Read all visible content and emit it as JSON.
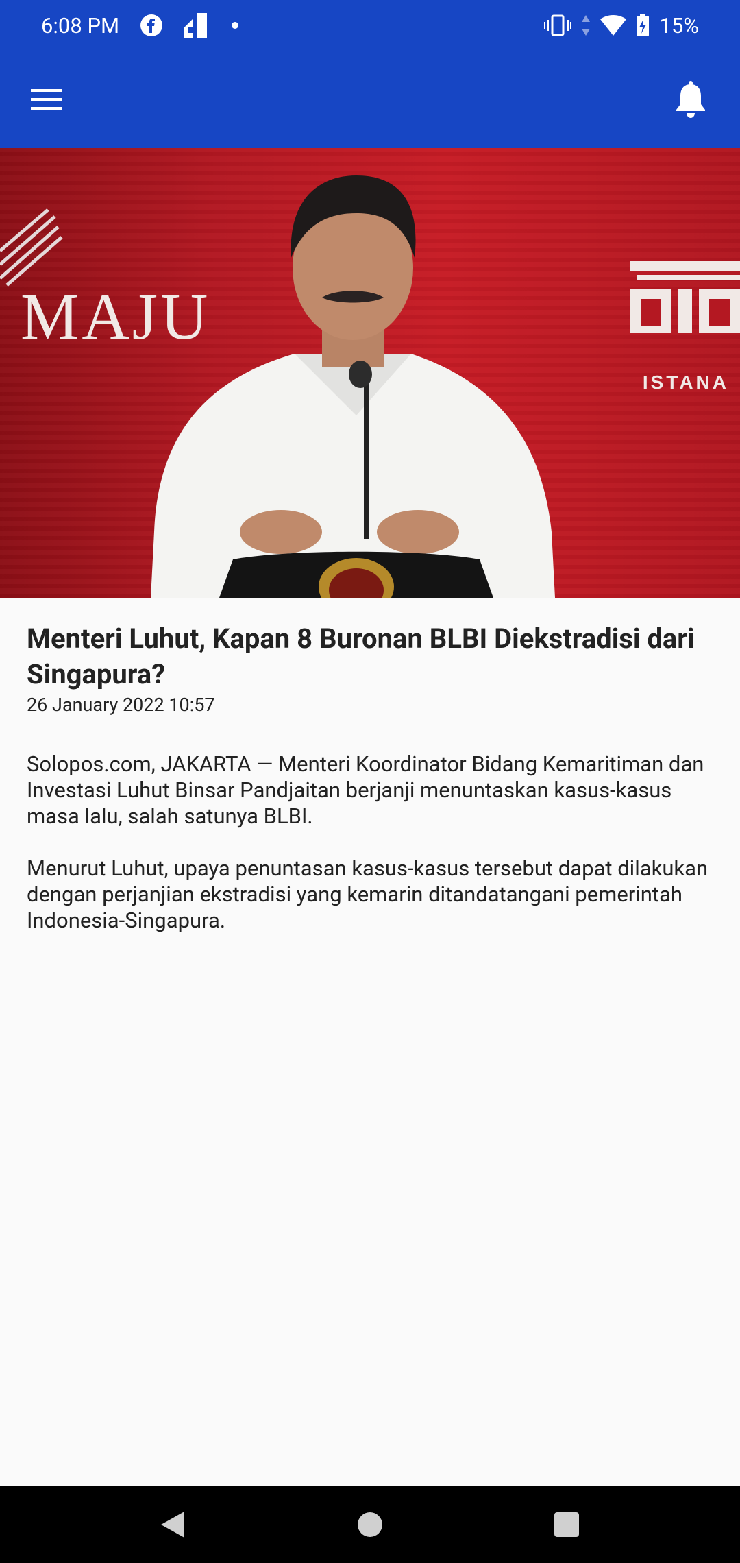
{
  "status_bar": {
    "time": "6:08 PM",
    "battery": "15%",
    "icons": [
      "facebook-icon",
      "notification-app-icon",
      "dot-icon",
      "vibrate-icon",
      "data-arrows-icon",
      "wifi-icon",
      "battery-charging-icon"
    ]
  },
  "app_bar": {
    "menu_icon": "hamburger-menu-icon",
    "notification_icon": "bell-icon",
    "background_color": "#1746c4"
  },
  "hero_image": {
    "description_icon": "photo",
    "left_text": "MAJU",
    "right_text": "ISTANA"
  },
  "article": {
    "title": "Menteri Luhut, Kapan 8 Buronan BLBI Diekstradisi dari Singapura?",
    "date": "26 January 2022 10:57",
    "paragraphs": [
      "Solopos.com, JAKARTA — Menteri Koordinator Bidang Kemaritiman dan Investasi Luhut Binsar Pandjaitan berjanji menuntaskan kasus-kasus masa lalu, salah satunya BLBI.",
      "Menurut Luhut, upaya penuntasan kasus-kasus tersebut dapat dilakukan dengan perjanjian ekstradisi yang kemarin ditandatangani pemerintah Indonesia-Singapura."
    ]
  },
  "nav_bar": {
    "buttons": [
      "back-icon",
      "home-icon",
      "recents-icon"
    ]
  }
}
